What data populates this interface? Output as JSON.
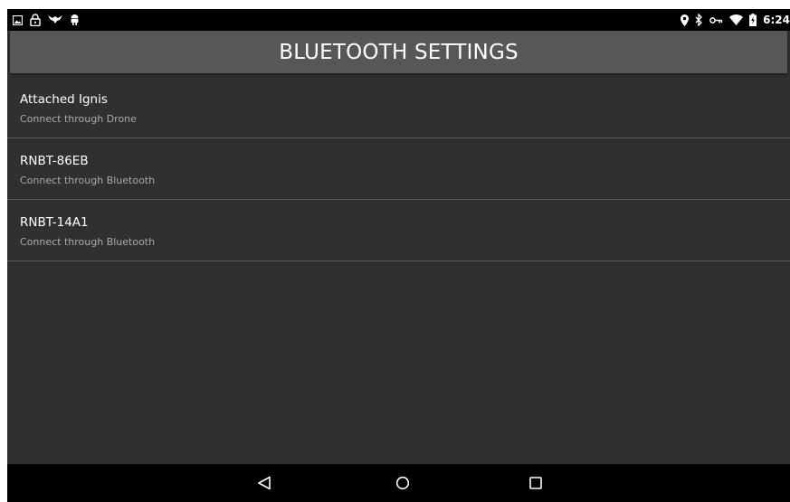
{
  "status_bar": {
    "left_icons": [
      "image-icon",
      "lock-icon",
      "drone-app-icon",
      "android-icon"
    ],
    "right_icons": [
      "location-icon",
      "bluetooth-icon",
      "vpn-key-icon",
      "wifi-icon",
      "battery-icon"
    ],
    "time": "6:24"
  },
  "app_bar": {
    "title": "BLUETOOTH SETTINGS",
    "background": "#575757"
  },
  "devices": [
    {
      "name": "Attached Ignis",
      "subtitle": "Connect through Drone"
    },
    {
      "name": "RNBT-86EB",
      "subtitle": "Connect through Bluetooth"
    },
    {
      "name": "RNBT-14A1",
      "subtitle": "Connect through Bluetooth"
    }
  ],
  "nav_bar": {
    "buttons": [
      "back-icon",
      "home-icon",
      "recents-icon"
    ]
  },
  "colors": {
    "screen_background": "#303030",
    "divider": "#5a5a5a",
    "subtitle_text": "#a9a9a9"
  }
}
